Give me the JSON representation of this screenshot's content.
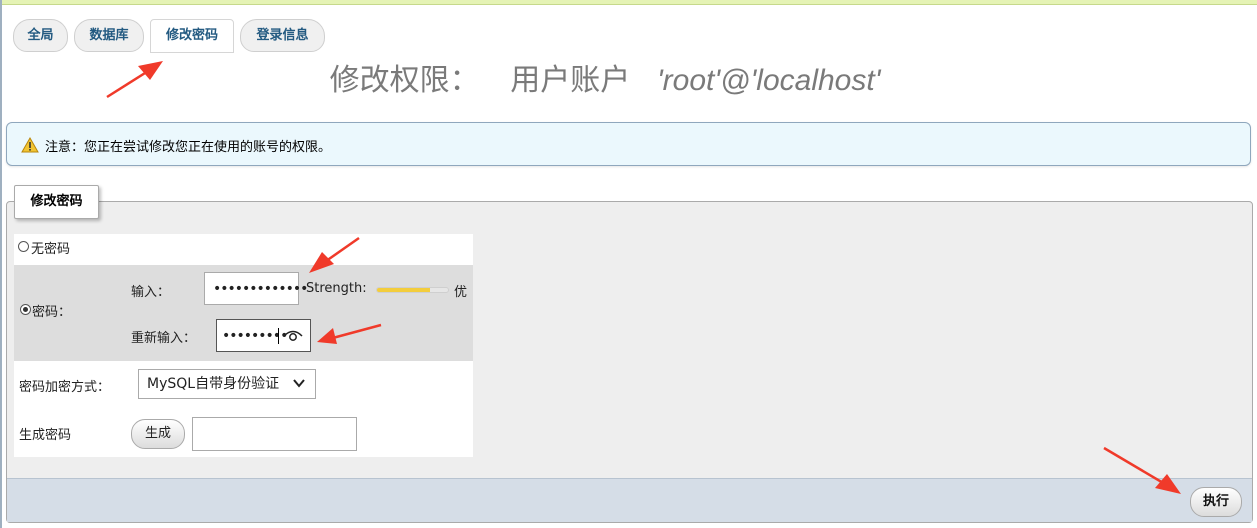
{
  "tabs": [
    {
      "label": "全局",
      "active": false
    },
    {
      "label": "数据库",
      "active": false
    },
    {
      "label": "修改密码",
      "active": true
    },
    {
      "label": "登录信息",
      "active": false
    }
  ],
  "title": {
    "prefix": "修改权限：",
    "account_label": "用户账户",
    "account_value": "'root'@'localhost'"
  },
  "notice": {
    "icon": "warning-icon",
    "text": "注意：您正在尝试修改您正在使用的账号的权限。"
  },
  "form": {
    "legend": "修改密码",
    "no_password_label": "无密码",
    "no_password_selected": false,
    "password_label": "密码：",
    "password_selected": true,
    "enter_label": "输入：",
    "enter_value": "•••••••••••••",
    "strength_label": "Strength:",
    "strength_value": 0.75,
    "strength_word": "优",
    "reenter_label": "重新输入：",
    "reenter_value": "•••••••••",
    "reveal_icon": "eye-icon",
    "hash_label": "密码加密方式：",
    "hash_value": "MySQL自带身份验证",
    "generate_label": "生成密码",
    "generate_button": "生成",
    "generate_value": ""
  },
  "footer": {
    "execute_button": "执行"
  },
  "colors": {
    "annotation_arrow": "#f03a2a",
    "link_blue": "#235a81",
    "notice_bg": "#ebf8fd",
    "footer_bg": "#d5dde7",
    "strength_fill": "#f3cd3c"
  }
}
